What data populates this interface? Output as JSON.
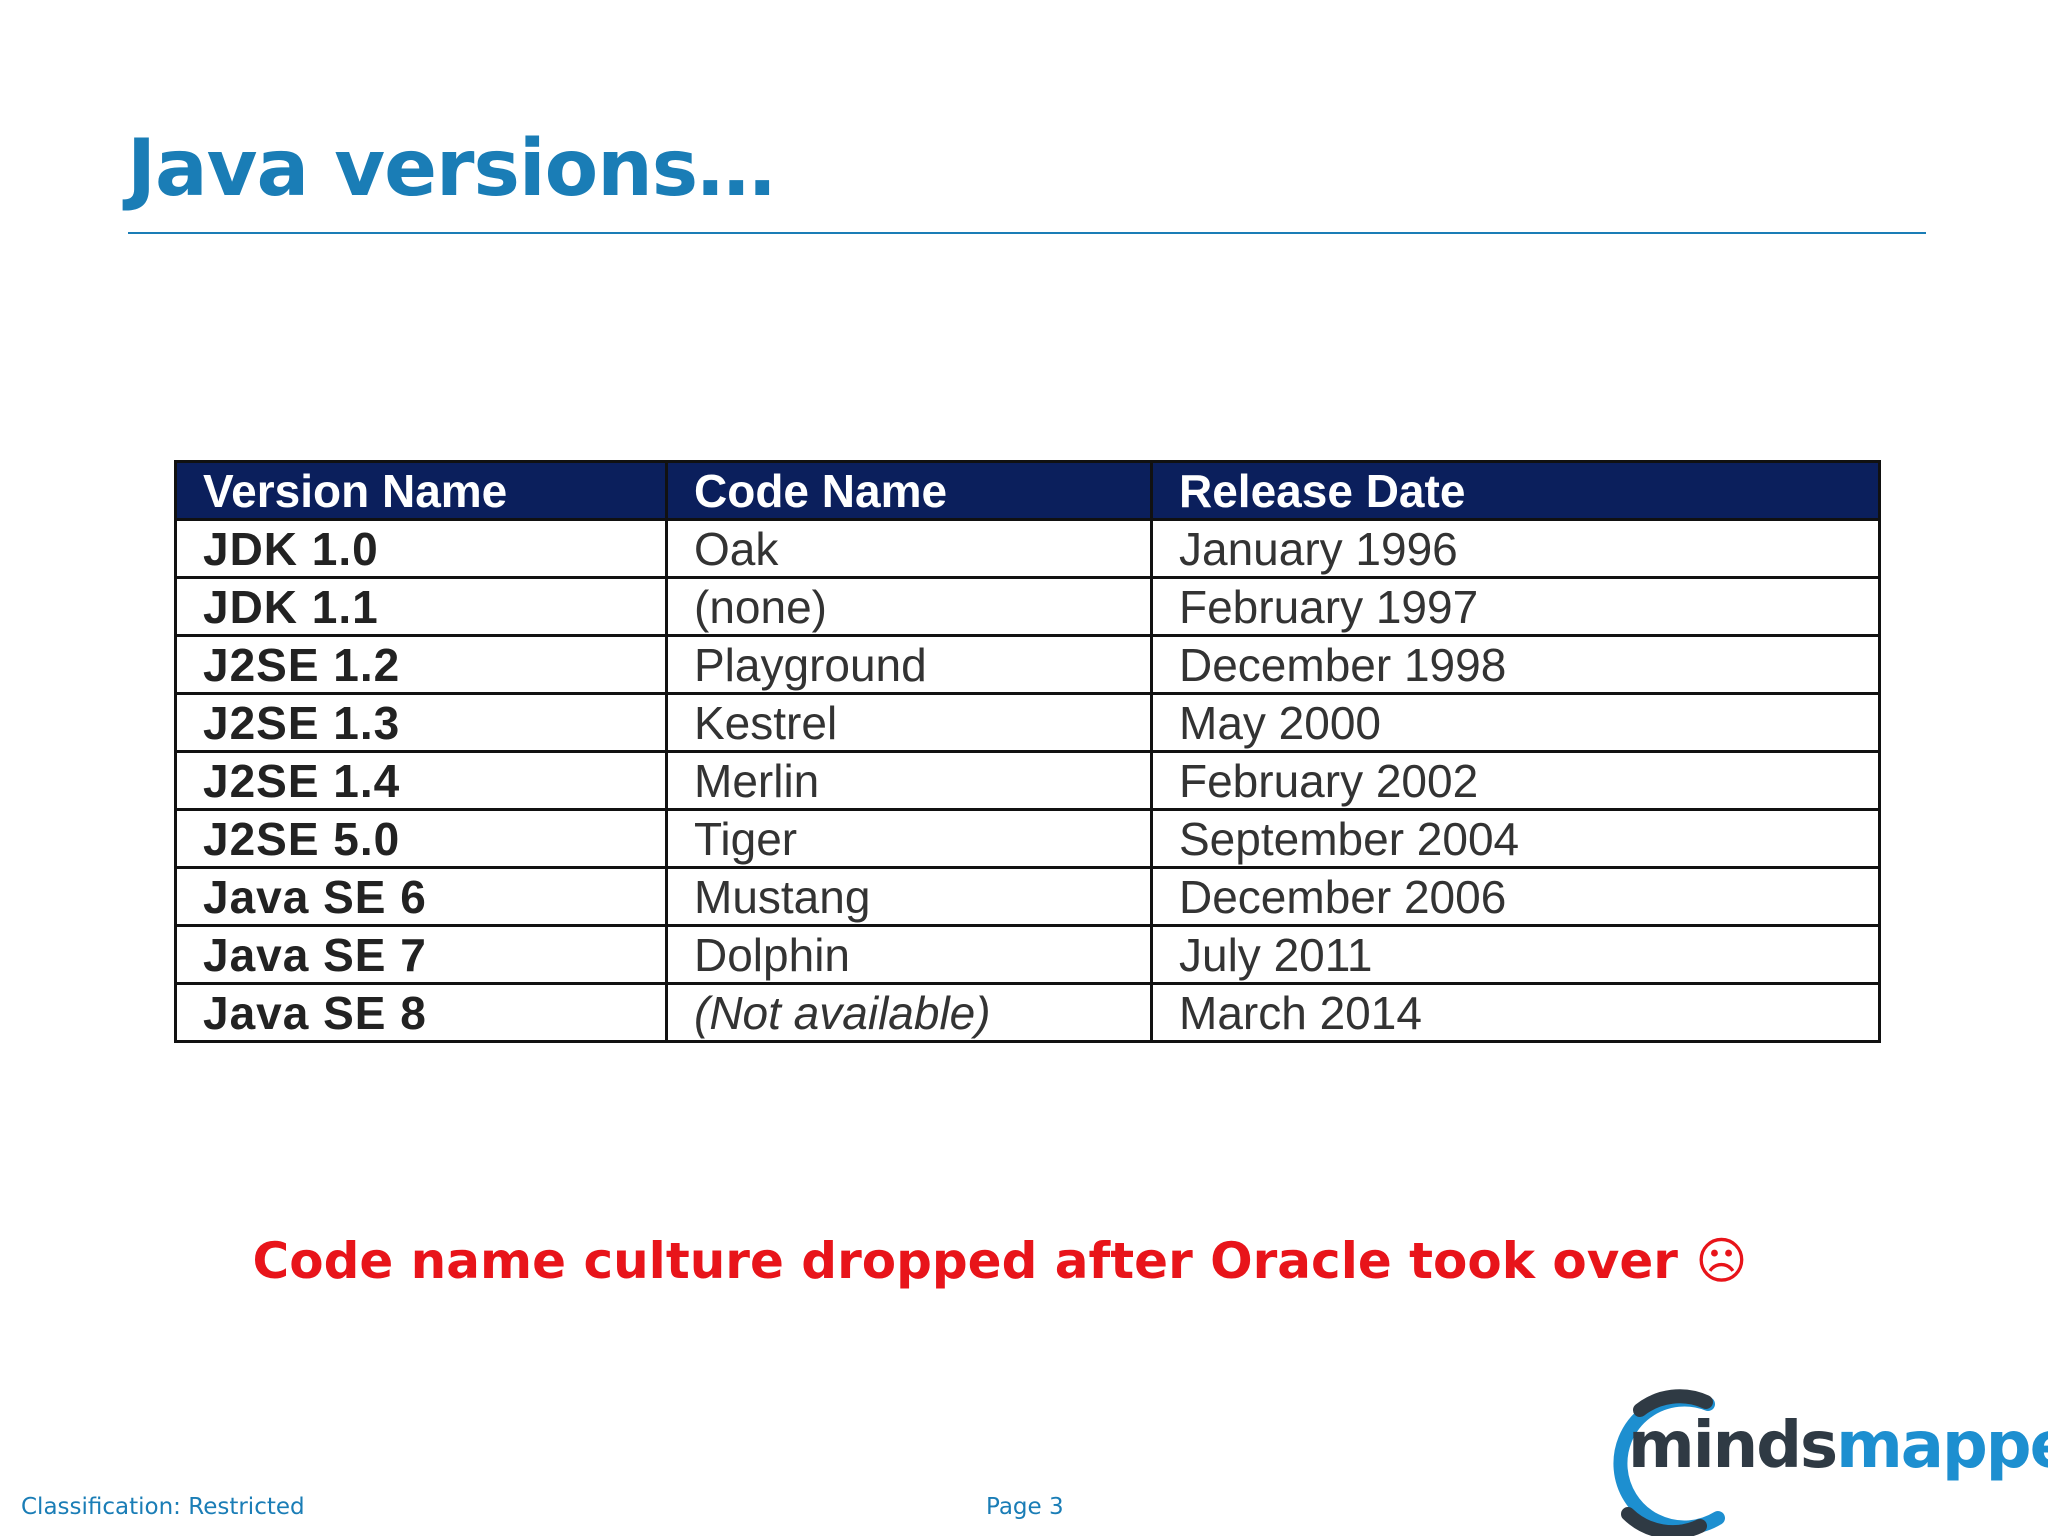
{
  "slide": {
    "title": "Java versions…",
    "callout": "Code name culture dropped after Oracle took over ☹"
  },
  "table": {
    "headers": [
      "Version Name",
      "Code Name",
      "Release Date"
    ],
    "rows": [
      {
        "version": "JDK 1.0",
        "code": "Oak",
        "date": "January 1996"
      },
      {
        "version": "JDK 1.1",
        "code": "(none)",
        "date": "February 1997"
      },
      {
        "version": "J2SE 1.2",
        "code": "Playground",
        "date": "December 1998"
      },
      {
        "version": "J2SE 1.3",
        "code": "Kestrel",
        "date": "May 2000"
      },
      {
        "version": "J2SE 1.4",
        "code": "Merlin",
        "date": "February 2002"
      },
      {
        "version": "J2SE 5.0",
        "code": "Tiger",
        "date": "September 2004"
      },
      {
        "version": "Java SE 6",
        "code": "Mustang",
        "date": "December 2006"
      },
      {
        "version": "Java SE 7",
        "code": "Dolphin",
        "date": "July 2011"
      },
      {
        "version": "Java SE 8",
        "code": "(Not available)",
        "date": "March 2014"
      }
    ]
  },
  "footer": {
    "classification": "Classification: Restricted",
    "page": "Page 3"
  },
  "logo": {
    "text_part1": "minds",
    "text_part2": "mapped",
    "ring_color": "#1d8fd0",
    "ring_dark_color": "#2f3a44"
  },
  "colors": {
    "title": "#1a7db6",
    "header_bg": "#0b1f5c",
    "callout": "#e8141a"
  }
}
